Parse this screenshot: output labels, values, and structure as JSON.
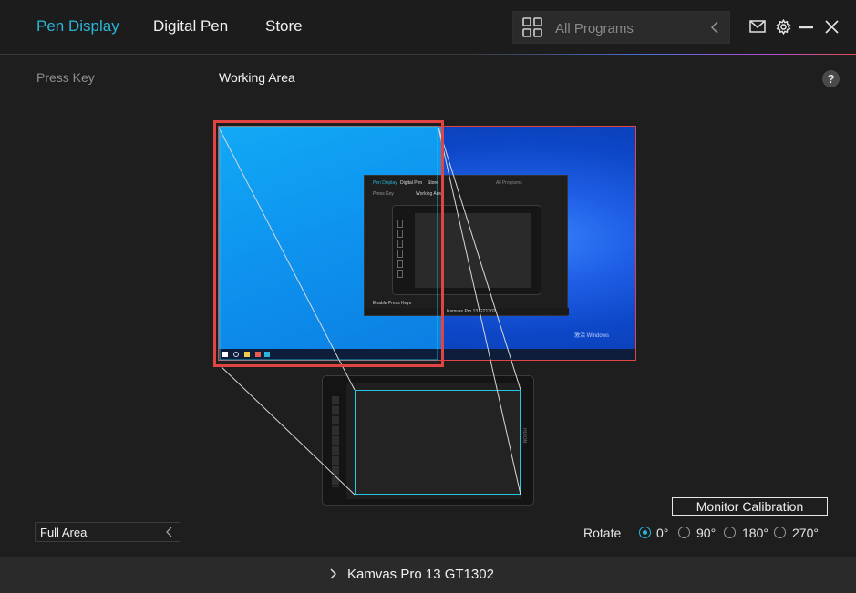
{
  "header": {
    "tabs": [
      {
        "label": "Pen Display",
        "active": true
      },
      {
        "label": "Digital Pen",
        "active": false
      },
      {
        "label": "Store",
        "active": false
      }
    ],
    "program_selector": {
      "placeholder": "All Programs"
    },
    "icons": [
      "grid-icon",
      "mail-icon",
      "gear-icon",
      "minimize-icon",
      "close-icon"
    ]
  },
  "subnav": {
    "press_key": "Press Key",
    "working_area": "Working Area",
    "help": "?"
  },
  "preview": {
    "mini_app": {
      "tabs": [
        "Pen Display",
        "Digital Pen",
        "Store"
      ],
      "program": "All Programs",
      "press_key": "Press Key",
      "working_area": "Working Area",
      "enable_press_keys": "Enable Press Keys",
      "device": "Kamvas Pro 13 GT1302"
    },
    "watermark": "激活 Windows"
  },
  "area_select": {
    "value": "Full Area"
  },
  "calibration": {
    "label": "Monitor Calibration"
  },
  "rotate": {
    "label": "Rotate",
    "options": [
      {
        "label": "0°",
        "checked": true
      },
      {
        "label": "90°",
        "checked": false
      },
      {
        "label": "180°",
        "checked": false
      },
      {
        "label": "270°",
        "checked": false
      }
    ]
  },
  "device": {
    "name": "Kamvas Pro 13 GT1302"
  },
  "colors": {
    "accent": "#29b6d8",
    "selection": "#e24444",
    "tablet_area": "#23c7e3"
  }
}
